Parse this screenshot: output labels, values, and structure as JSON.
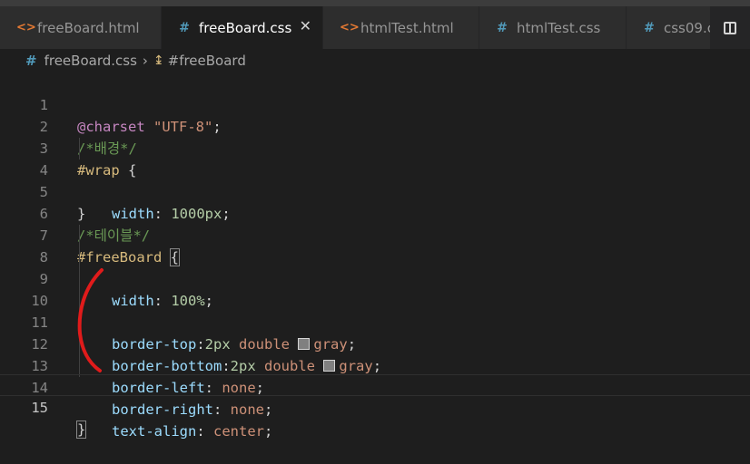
{
  "tabs": [
    {
      "label": "freeBoard.html",
      "icon": "html-file-icon"
    },
    {
      "label": "freeBoard.css",
      "icon": "css-file-icon",
      "active": true
    },
    {
      "label": "htmlTest.html",
      "icon": "html-file-icon"
    },
    {
      "label": "htmlTest.css",
      "icon": "css-file-icon"
    },
    {
      "label": "css09.c",
      "icon": "css-file-icon"
    }
  ],
  "breadcrumb": {
    "file": "freeBoard.css",
    "symbol": "#freeBoard"
  },
  "editor": {
    "line_numbers": [
      "1",
      "2",
      "3",
      "4",
      "5",
      "6",
      "7",
      "8",
      "9",
      "10",
      "11",
      "12",
      "13",
      "14",
      "15"
    ],
    "current_line": "15",
    "code": {
      "l1": {
        "at": "@charset",
        "str": "\"UTF-8\"",
        "end": ";"
      },
      "l2": {
        "comment": "/*배경*/"
      },
      "l3": {
        "selector": "#wrap",
        "brace": " {"
      },
      "l4": {
        "prop": "width",
        "colon": ": ",
        "num": "1000px",
        "end": ";"
      },
      "l5": {
        "brace": "}"
      },
      "l6": {
        "comment": "/*테이블*/"
      },
      "l7": {
        "selector": "#freeBoard",
        "brace": "{"
      },
      "l8": {
        "prop": "width",
        "colon": ": ",
        "num": "100%",
        "end": ";"
      },
      "l10": {
        "prop": "border-top",
        "colon": ":",
        "num": "2px",
        "v1": "double",
        "color": "gray",
        "end": ";"
      },
      "l11": {
        "prop": "border-bottom",
        "colon": ":",
        "num": "2px",
        "v1": "double",
        "color": "gray",
        "end": ";"
      },
      "l12": {
        "prop": "border-left",
        "colon": ": ",
        "val": "none",
        "end": ";"
      },
      "l13": {
        "prop": "border-right",
        "colon": ": ",
        "val": "none",
        "end": ";"
      },
      "l14": {
        "prop": "text-align",
        "colon": ": ",
        "val": "center",
        "end": ";"
      },
      "l15": {
        "brace": "}"
      }
    }
  },
  "colors": {
    "background": "#1e1e1e",
    "annotation_stroke": "#e01b1b",
    "swatch_gray": "#808080"
  }
}
